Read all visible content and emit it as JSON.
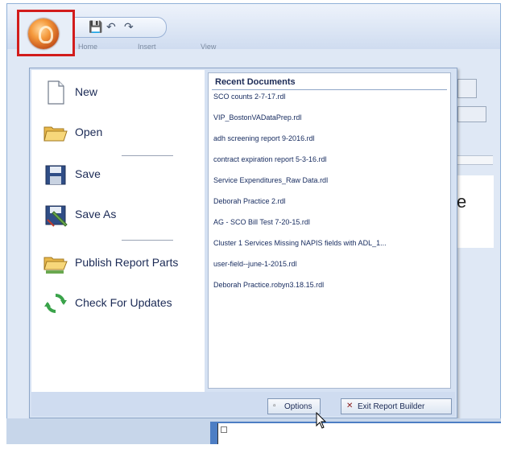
{
  "quick_access": {
    "save_glyph": "💾",
    "undo_glyph": "↶",
    "redo_glyph": "↷"
  },
  "ribbon_tabs": [
    "Home",
    "Insert",
    "View"
  ],
  "menu": {
    "items": [
      {
        "label": "New",
        "icon": "new-document-icon"
      },
      {
        "label": "Open",
        "icon": "open-folder-icon"
      },
      {
        "label": "Save",
        "icon": "save-disk-icon"
      },
      {
        "label": "Save As",
        "icon": "save-as-icon"
      },
      {
        "label": "Publish Report Parts",
        "icon": "publish-folder-icon"
      },
      {
        "label": "Check For Updates",
        "icon": "refresh-arrows-icon"
      }
    ],
    "recent_header": "Recent Documents",
    "recent_documents": [
      "SCO counts 2-7-17.rdl",
      "VIP_BostonVADataPrep.rdl",
      "adh screening report 9-2016.rdl",
      "contract expiration report 5-3-16.rdl",
      "Service Expenditures_Raw Data.rdl",
      "Deborah Practice 2.rdl",
      "AG - SCO Bill Test 7-20-15.rdl",
      "Cluster 1 Services Missing NAPIS fields with ADL_1...",
      "user-field--june-1-2015.rdl",
      "Deborah Practice.robyn3.18.15.rdl"
    ],
    "options_label": "Options",
    "exit_label": "Exit Report Builder"
  },
  "canvas_glyph": "e",
  "colors": {
    "highlight": "#d21c1c",
    "menu_bg": "#d6e2f3",
    "text": "#1b2a55"
  }
}
